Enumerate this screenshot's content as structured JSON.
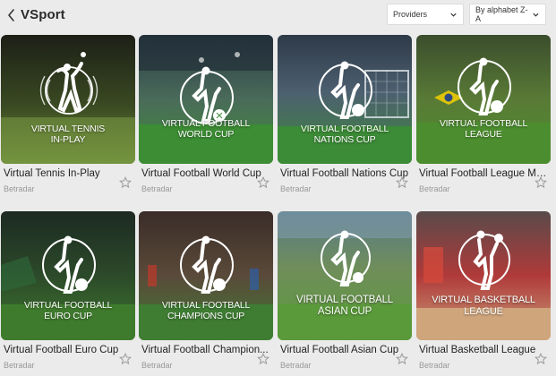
{
  "header": {
    "title": "VSport",
    "providers_label": "Providers",
    "sort_label": "By alphabet Z-A"
  },
  "games": [
    {
      "name": "Virtual Tennis In-Play",
      "provider": "Betradar",
      "caption1": "VIRTUAL TENNIS",
      "caption2": "IN-PLAY",
      "theme": "tennis"
    },
    {
      "name": "Virtual Football World Cup",
      "provider": "Betradar",
      "caption1": "VIRTUAL FOOTBALL",
      "caption2": "WORLD CUP",
      "theme": "stadium"
    },
    {
      "name": "Virtual Football Nations Cup",
      "provider": "Betradar",
      "caption1": "VIRTUAL FOOTBALL",
      "caption2": "NATIONS CUP",
      "theme": "goal"
    },
    {
      "name": "Virtual Football League Mo...",
      "provider": "Betradar",
      "caption1": "VIRTUAL FOOTBALL",
      "caption2": "LEAGUE",
      "theme": "league"
    },
    {
      "name": "Virtual Football Euro Cup",
      "provider": "Betradar",
      "caption1": "VIRTUAL FOOTBALL",
      "caption2": "EURO CUP",
      "theme": "euro"
    },
    {
      "name": "Virtual Football Champion...",
      "provider": "Betradar",
      "caption1": "VIRTUAL FOOTBALL",
      "caption2": "CHAMPIONS CUP",
      "theme": "champions"
    },
    {
      "name": "Virtual Football Asian Cup",
      "provider": "Betradar",
      "caption1": "VIRTUAL FOOTBALL",
      "caption2": "ASIAN CUP",
      "theme": "asian"
    },
    {
      "name": "Virtual Basketball League",
      "provider": "Betradar",
      "caption1": "VIRTUAL BASKETBALL",
      "caption2": "LEAGUE",
      "theme": "basketball"
    }
  ],
  "colors": {
    "background": "#ebebeb",
    "star": "#9a9a9a",
    "provider_text": "#999999"
  }
}
